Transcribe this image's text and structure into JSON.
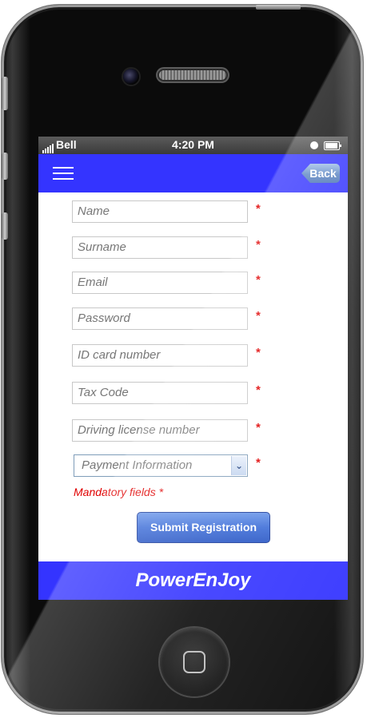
{
  "status_bar": {
    "carrier": "Bell",
    "time": "4:20 PM"
  },
  "navbar": {
    "back_label": "Back"
  },
  "form": {
    "fields": [
      {
        "placeholder": "Name",
        "required_mark": "*"
      },
      {
        "placeholder": "Surname",
        "required_mark": "*"
      },
      {
        "placeholder": "Email",
        "required_mark": "*"
      },
      {
        "placeholder": "Password",
        "required_mark": "*"
      },
      {
        "placeholder": "ID card number",
        "required_mark": "*"
      },
      {
        "placeholder": "Tax Code",
        "required_mark": "*"
      },
      {
        "placeholder": "Driving license number",
        "required_mark": "*"
      }
    ],
    "payment": {
      "selected": "Payment Information",
      "required_mark": "*"
    },
    "mandatory_note": "Mandatory fields *",
    "submit_label": "Submit Registration"
  },
  "footer": {
    "brand": "PowerEnJoy"
  },
  "colors": {
    "accent": "#3434ff",
    "required": "#e00000",
    "button": "#3f6fd8"
  }
}
